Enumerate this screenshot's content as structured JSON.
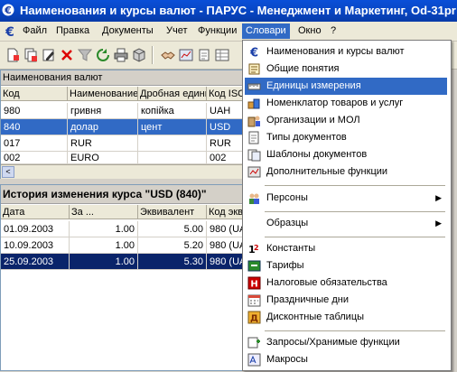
{
  "window": {
    "title": "Наименования и курсы валют - ПАРУС - Менеджмент и Маркетинг, Od-31pr",
    "app_icon": "euro-icon"
  },
  "menubar": {
    "items": [
      {
        "label": "Файл",
        "name": "menu-file"
      },
      {
        "label": "Правка",
        "name": "menu-edit"
      },
      {
        "label": "Документы",
        "name": "menu-documents"
      },
      {
        "label": "Учет",
        "name": "menu-accounting"
      },
      {
        "label": "Функции",
        "name": "menu-functions"
      },
      {
        "label": "Словари",
        "name": "menu-dictionaries",
        "active": true
      },
      {
        "label": "Окно",
        "name": "menu-window"
      },
      {
        "label": "?",
        "name": "menu-help"
      }
    ]
  },
  "toolbar": {
    "icons": [
      "new-record-icon",
      "copy-record-icon",
      "edit-record-icon",
      "delete-icon",
      "filter-icon",
      "refresh-icon",
      "print-icon",
      "export-icon",
      "handshake-icon",
      "report-icon"
    ]
  },
  "currencies": {
    "caption": "Наименования валют",
    "columns": [
      "Код",
      "Наименование",
      "Дробная единица",
      "Код ISO"
    ],
    "rows": [
      {
        "code": "980",
        "name": "гривня",
        "fraction": "копійка",
        "iso": "UAH"
      },
      {
        "code": "840",
        "name": "долар",
        "fraction": "цент",
        "iso": "USD",
        "selected": true
      },
      {
        "code": "017",
        "name": "RUR",
        "fraction": "",
        "iso": "RUR"
      },
      {
        "code": "002",
        "name": "EURO",
        "fraction": "",
        "iso": "002"
      }
    ]
  },
  "history": {
    "caption": "История изменения курса  \"USD (840)\"",
    "columns": [
      "Дата",
      "За ...",
      "Эквивалент",
      "Код эквивалента"
    ],
    "rows": [
      {
        "date": "01.09.2003",
        "per": "1.00",
        "equiv": "5.00",
        "code": "980 (UAH)"
      },
      {
        "date": "10.09.2003",
        "per": "1.00",
        "equiv": "5.20",
        "code": "980 (UAH)"
      },
      {
        "date": "25.09.2003",
        "per": "1.00",
        "equiv": "5.30",
        "code": "980 (UAH)",
        "selected": true
      }
    ]
  },
  "dropdown": {
    "items": [
      {
        "label": "Наименования и курсы валют",
        "icon": "euro-icon",
        "name": "dd-currency-names"
      },
      {
        "label": "Общие понятия",
        "icon": "book-icon",
        "name": "dd-general-concepts"
      },
      {
        "label": "Единицы измерения",
        "icon": "ruler-icon",
        "name": "dd-units",
        "highlight": true
      },
      {
        "label": "Номенклатор товаров и услуг",
        "icon": "goods-icon",
        "name": "dd-nomenclature"
      },
      {
        "label": "Организации и МОЛ",
        "icon": "organization-icon",
        "name": "dd-organizations"
      },
      {
        "label": "Типы документов",
        "icon": "document-types-icon",
        "name": "dd-doc-types"
      },
      {
        "label": "Шаблоны документов",
        "icon": "templates-icon",
        "name": "dd-doc-templates"
      },
      {
        "label": "Дополнительные функции",
        "icon": "functions-icon",
        "name": "dd-extra-functions"
      },
      {
        "label": "Персоны",
        "icon": "persons-icon",
        "name": "dd-persons",
        "submenu": true
      },
      {
        "label": "Образцы",
        "icon": "",
        "name": "dd-samples",
        "submenu": true
      },
      {
        "label": "Константы",
        "icon": "constants-icon",
        "name": "dd-constants"
      },
      {
        "label": "Тарифы",
        "icon": "tariffs-icon",
        "name": "dd-tariffs"
      },
      {
        "label": "Налоговые обязательства",
        "icon": "tax-icon",
        "name": "dd-tax"
      },
      {
        "label": "Праздничные дни",
        "icon": "calendar-icon",
        "name": "dd-holidays"
      },
      {
        "label": "Дисконтные таблицы",
        "icon": "discount-icon",
        "name": "dd-discount"
      },
      {
        "label": "Запросы/Хранимые функции",
        "icon": "queries-icon",
        "name": "dd-queries"
      },
      {
        "label": "Макросы",
        "icon": "macros-icon",
        "name": "dd-macros"
      }
    ]
  }
}
